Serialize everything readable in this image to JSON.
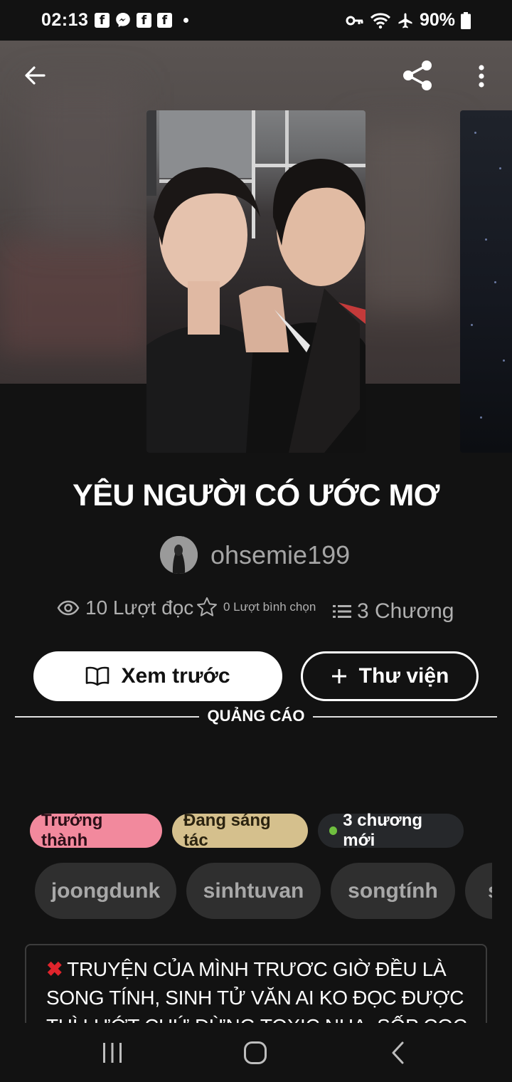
{
  "status_bar": {
    "time": "02:13",
    "notifications": [
      "facebook-icon",
      "messenger-icon",
      "facebook-icon",
      "facebook-icon"
    ],
    "battery": "90%"
  },
  "story": {
    "title": "YÊU NGƯỜI CÓ ƯỚC MƠ",
    "author": "ohsemie199",
    "stats": {
      "reads": "10 Lượt đọc",
      "votes": "0 Lượt bình chọn",
      "chapters": "3 Chương"
    },
    "buttons": {
      "preview": "Xem trước",
      "library": "Thư viện"
    },
    "ad_label": "QUẢNG CÁO",
    "badges": {
      "mature": "Trưởng thành",
      "ongoing": "Đang sáng tác",
      "new_chapters": "3 chương mới"
    },
    "tags": [
      "joongdunk",
      "sinhtuvan",
      "songtính",
      "s"
    ],
    "description": "TRUYỆN CỦA MÌNH TRƯƠC GIỜ ĐỀU LÀ SONG TÍNH, SINH TỬ VĂN AI KO ĐỌC ĐƯỢC THÌ LƯỚT CHỨ ĐỪNG TOXIC NHA. SỐP CỌC"
  },
  "colors": {
    "background": "#121212",
    "mature_badge": "#f2899d",
    "ongoing_badge": "#d5c08d",
    "new_dot": "#6fbf3f"
  }
}
